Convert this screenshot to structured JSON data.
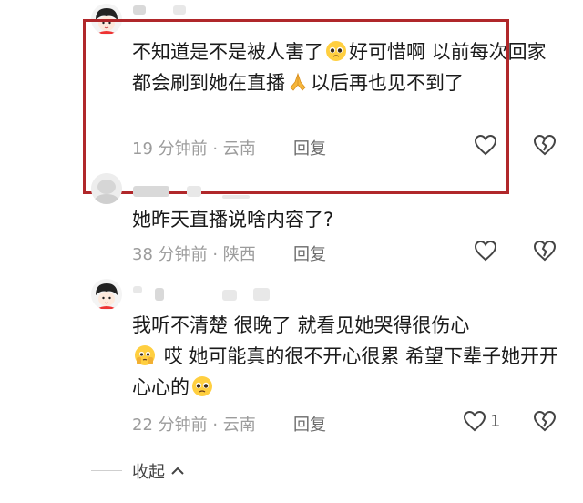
{
  "comments": [
    {
      "text_a": "不知道是不是被人害了",
      "text_b": "好可惜啊 以前每次回家都会刷到她在直播",
      "text_c": "以后再也见不到了",
      "meta": "19 分钟前 · 云南",
      "reply_label": "回复",
      "like_count": ""
    },
    {
      "text": "她昨天直播说啥内容了?",
      "meta": "38 分钟前 · 陕西",
      "reply_label": "回复",
      "like_count": ""
    },
    {
      "text_a": "我听不清楚  很晚了  就看见她哭得很伤心",
      "text_b": "哎  她可能真的很不开心很累  希望下辈子她开开心心的",
      "meta": "22 分钟前 · 云南",
      "reply_label": "回复",
      "like_count": "1"
    }
  ],
  "collapse_label": "收起",
  "icons": {
    "like": "heart-outline-icon",
    "dislike": "broken-heart-icon",
    "pleading": "pleading-face-emoji",
    "pray": "folded-hands-emoji",
    "holding_tears": "face-holding-back-tears-emoji",
    "chevron": "chevron-up-icon"
  },
  "colors": {
    "highlight_border": "#b0272a",
    "meta_gray": "#9c9c9c"
  }
}
